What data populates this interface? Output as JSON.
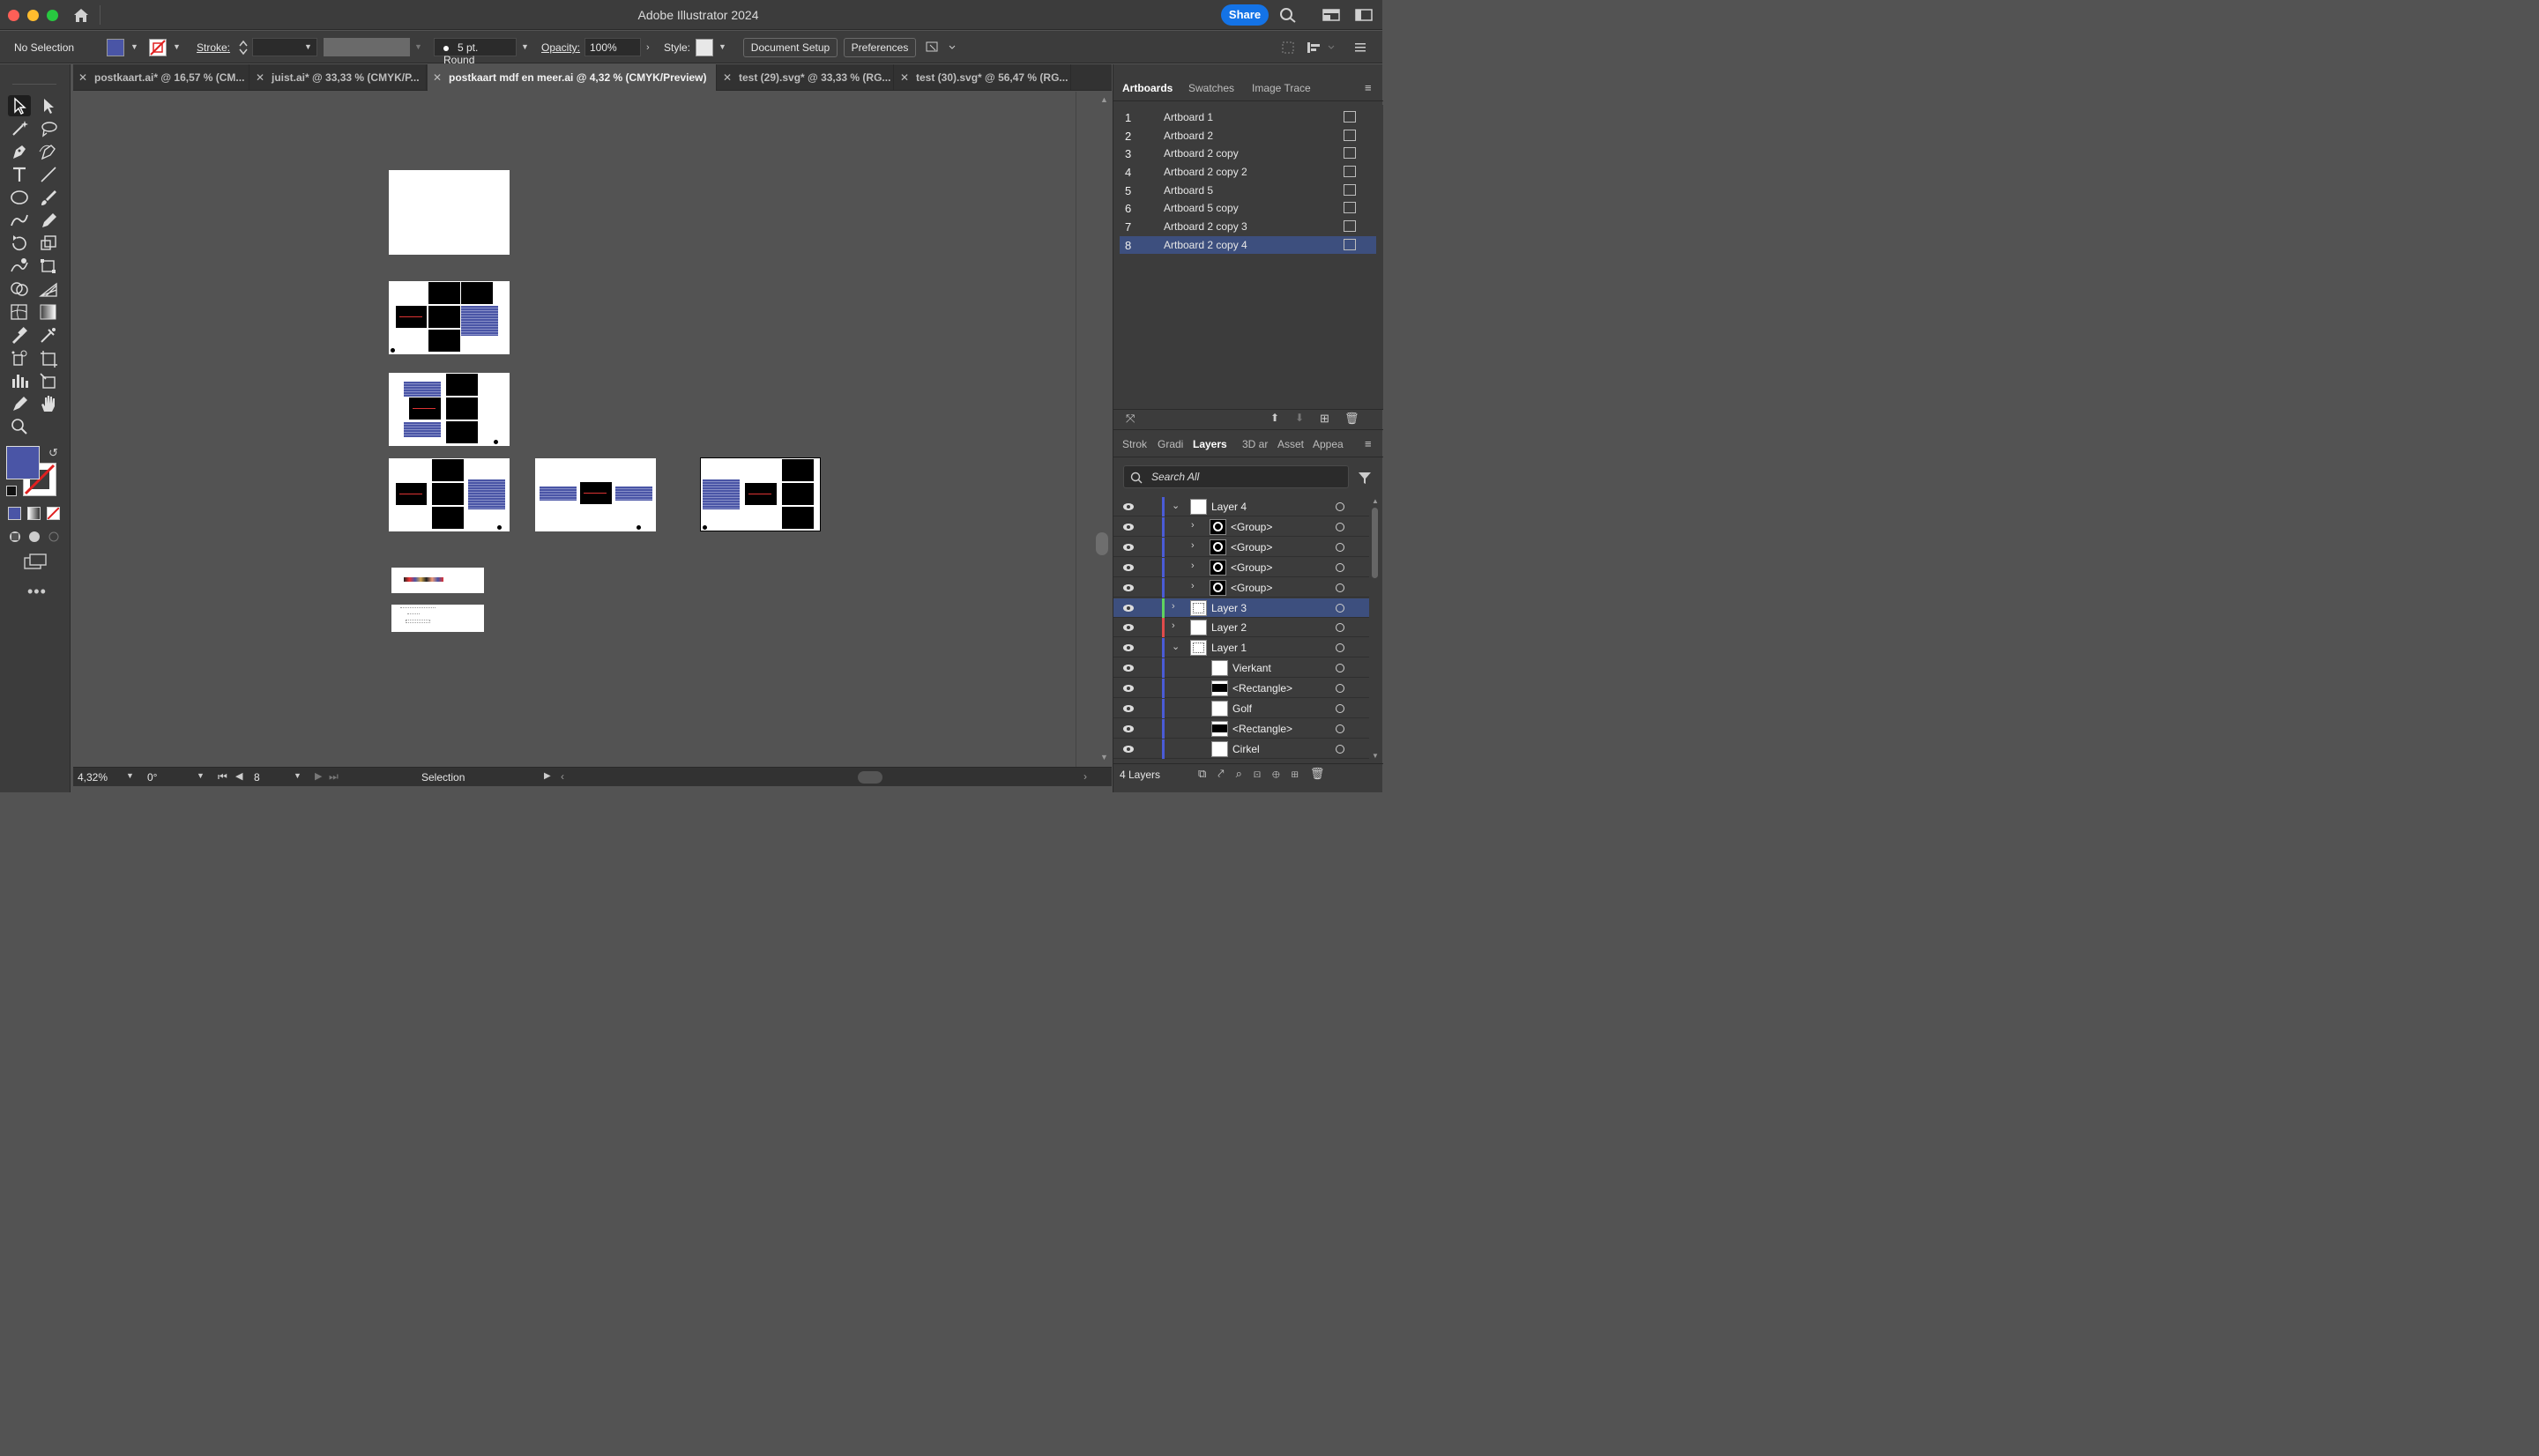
{
  "window": {
    "title": "Adobe Illustrator 2024",
    "share_label": "Share"
  },
  "control_bar": {
    "selection_label": "No Selection",
    "fill_color": "#4a55a6",
    "stroke_label": "Stroke:",
    "brush_label": "5 pt. Round",
    "opacity_label": "Opacity:",
    "opacity_value": "100%",
    "style_label": "Style:",
    "document_setup_label": "Document Setup",
    "preferences_label": "Preferences"
  },
  "tabs": [
    {
      "label": "postkaart.ai* @ 16,57 % (CM...",
      "active": false
    },
    {
      "label": "juist.ai* @ 33,33 % (CMYK/P...",
      "active": false
    },
    {
      "label": "postkaart mdf en meer.ai @ 4,32 % (CMYK/Preview)",
      "active": true
    },
    {
      "label": "test (29).svg* @ 33,33 % (RG...",
      "active": false
    },
    {
      "label": "test (30).svg* @ 56,47 % (RG...",
      "active": false
    }
  ],
  "status_bar": {
    "zoom": "4,32%",
    "rotation": "0°",
    "artboard_number": "8",
    "status_text": "Selection"
  },
  "artboards_panel": {
    "tabs": [
      "Artboards",
      "Swatches",
      "Image Trace"
    ],
    "items": [
      {
        "num": "1",
        "name": "Artboard 1"
      },
      {
        "num": "2",
        "name": "Artboard 2"
      },
      {
        "num": "3",
        "name": "Artboard 2 copy"
      },
      {
        "num": "4",
        "name": "Artboard 2 copy 2"
      },
      {
        "num": "5",
        "name": "Artboard 5"
      },
      {
        "num": "6",
        "name": "Artboard 5 copy"
      },
      {
        "num": "7",
        "name": "Artboard 2 copy 3"
      },
      {
        "num": "8",
        "name": "Artboard 2 copy 4"
      }
    ],
    "selected_index": 8
  },
  "layers_panel": {
    "tabs": [
      "Strok",
      "Gradi",
      "Layers",
      "3D ar",
      "Asset",
      "Appea"
    ],
    "search_placeholder": "Search All",
    "layers": [
      {
        "name": "Layer 4",
        "color": "#4a5bd6",
        "depth": 0,
        "expanded": true,
        "thumb": "white"
      },
      {
        "name": "<Group>",
        "color": "#4a5bd6",
        "depth": 1,
        "expanded": false,
        "thumb": "ring"
      },
      {
        "name": "<Group>",
        "color": "#4a5bd6",
        "depth": 1,
        "expanded": false,
        "thumb": "ring"
      },
      {
        "name": "<Group>",
        "color": "#4a5bd6",
        "depth": 1,
        "expanded": false,
        "thumb": "ring"
      },
      {
        "name": "<Group>",
        "color": "#4a5bd6",
        "depth": 1,
        "expanded": false,
        "thumb": "ring"
      },
      {
        "name": "Layer 3",
        "color": "#5fd35f",
        "depth": 0,
        "expanded": false,
        "thumb": "dots",
        "selected": true
      },
      {
        "name": "Layer 2",
        "color": "#e04b4b",
        "depth": 0,
        "expanded": false,
        "thumb": "white"
      },
      {
        "name": "Layer 1",
        "color": "#4a5bd6",
        "depth": 0,
        "expanded": true,
        "thumb": "dots"
      },
      {
        "name": "Vierkant",
        "color": "#4a5bd6",
        "depth": 2,
        "thumb": "white"
      },
      {
        "name": "<Rectangle>",
        "color": "#4a5bd6",
        "depth": 2,
        "thumb": "black"
      },
      {
        "name": "Golf",
        "color": "#4a5bd6",
        "depth": 2,
        "thumb": "white"
      },
      {
        "name": "<Rectangle>",
        "color": "#4a5bd6",
        "depth": 2,
        "thumb": "black"
      },
      {
        "name": "Cirkel",
        "color": "#4a5bd6",
        "depth": 2,
        "thumb": "white"
      }
    ],
    "footer_count": "4 Layers"
  }
}
